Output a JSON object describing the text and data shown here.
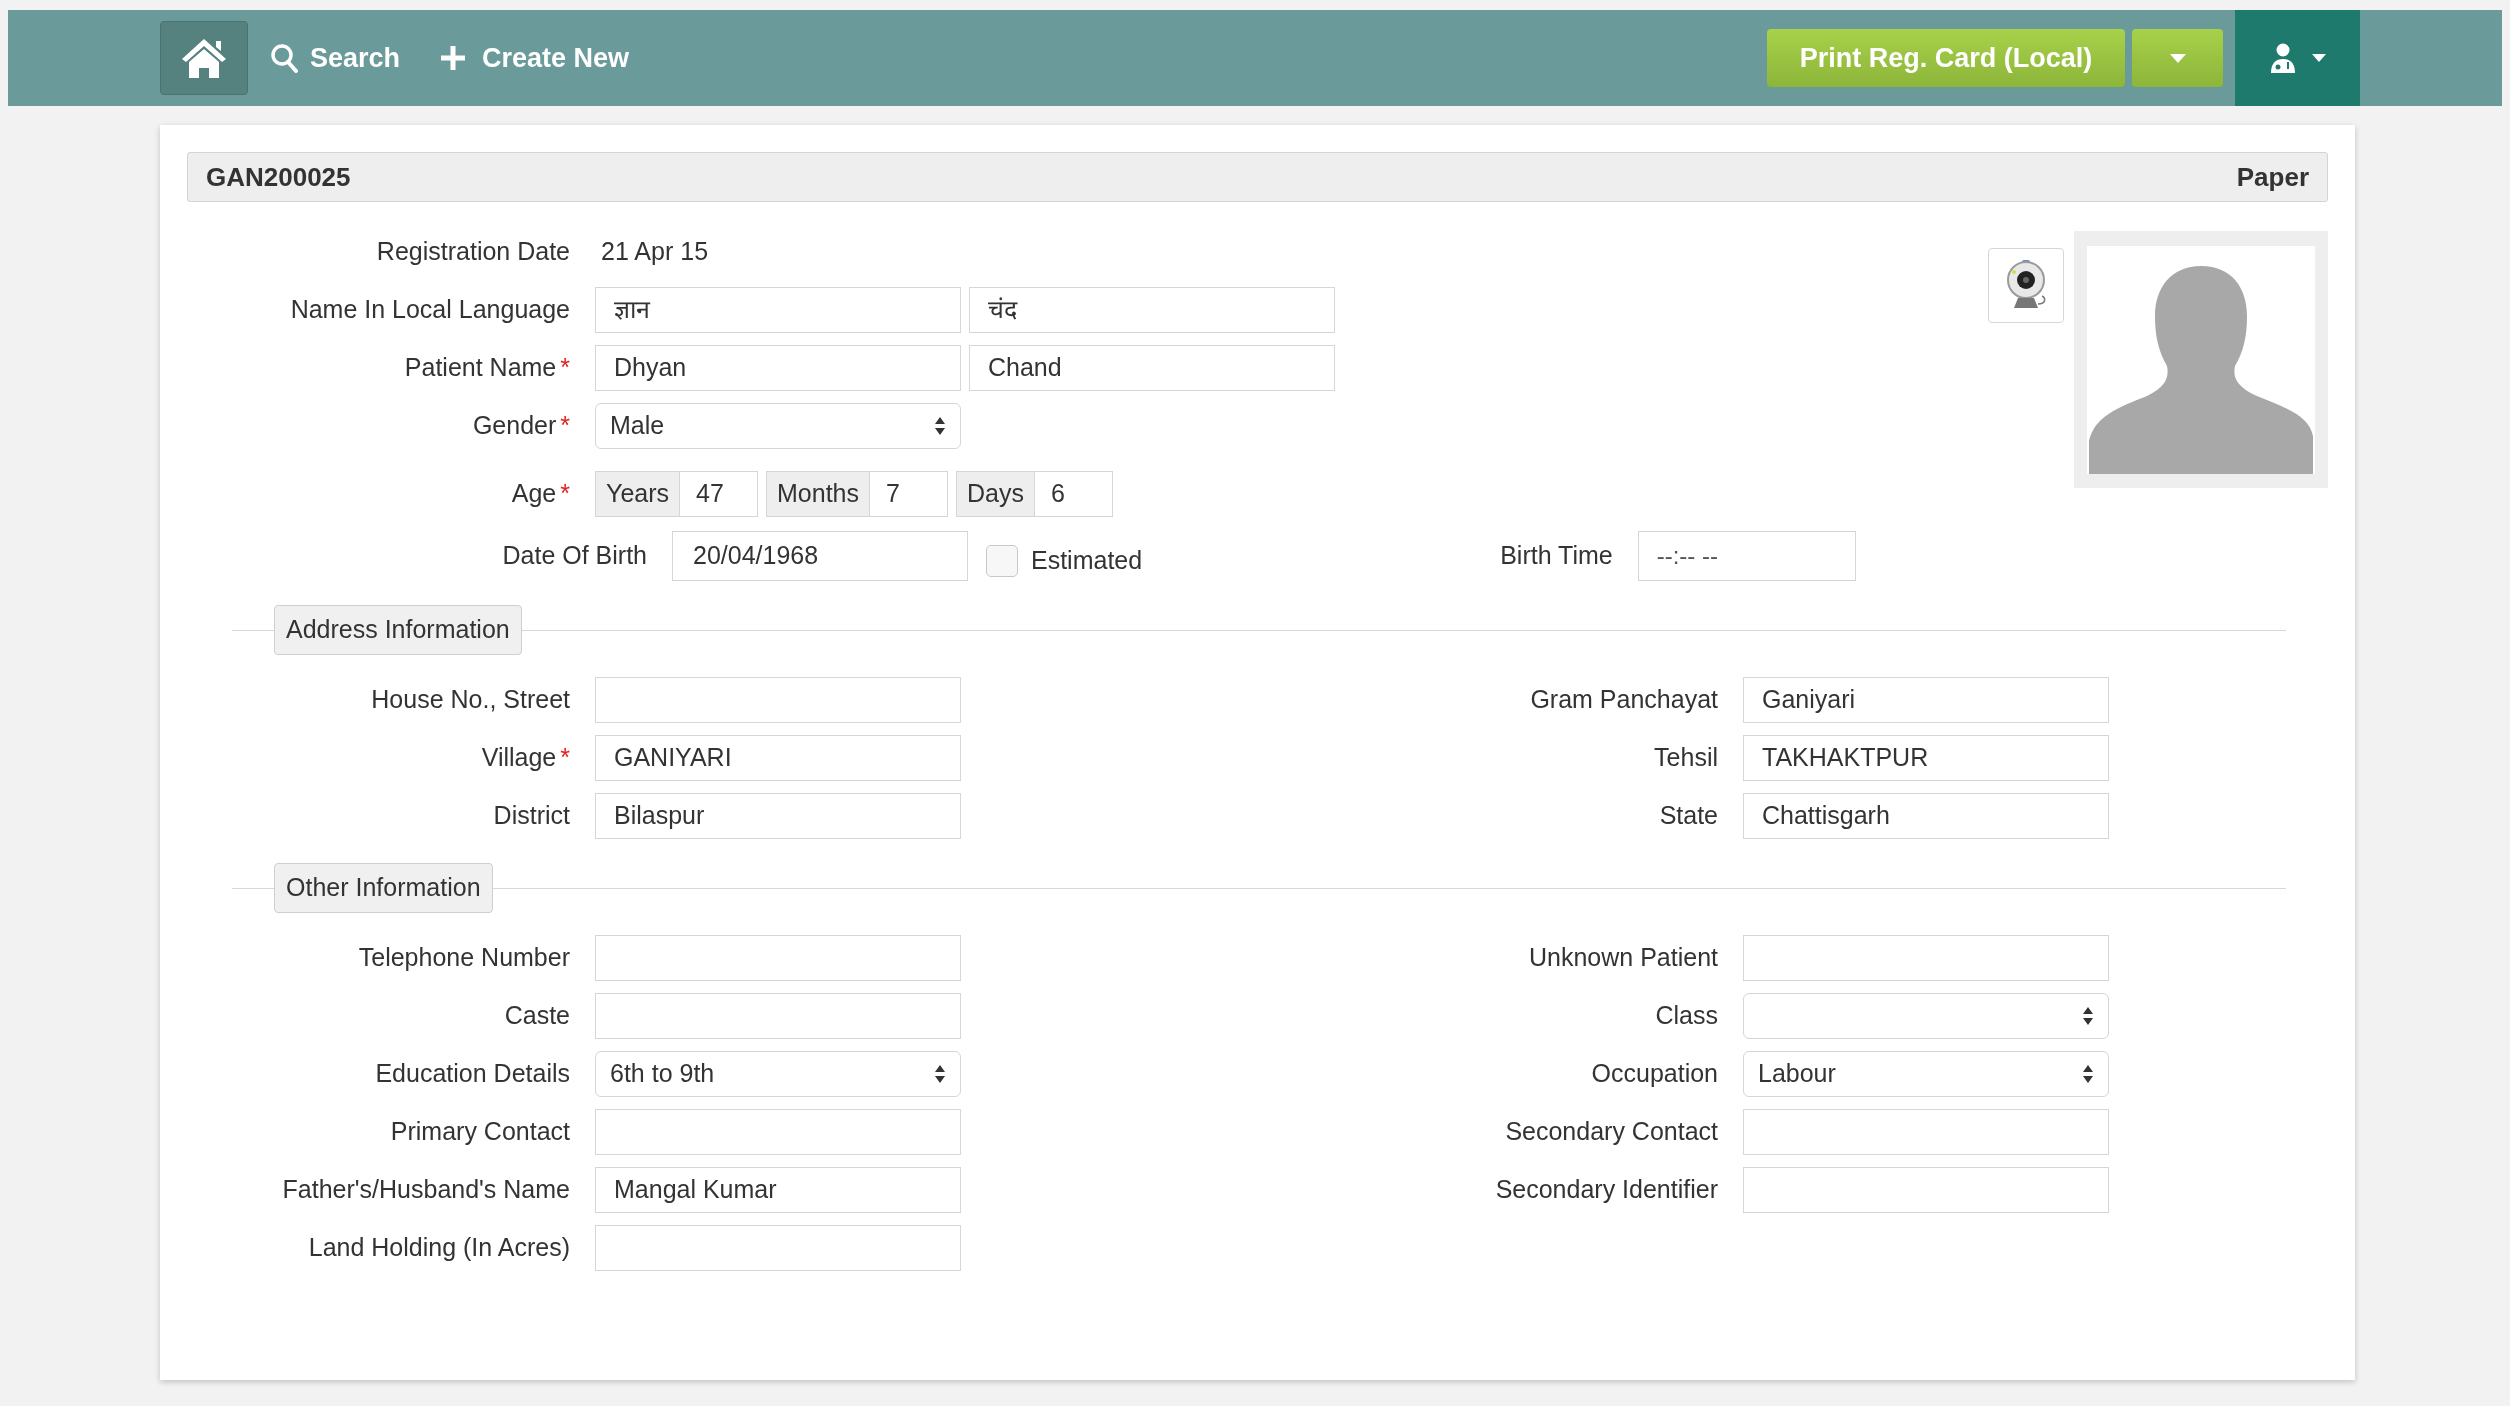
{
  "nav": {
    "search": "Search",
    "create": "Create New",
    "print": "Print Reg. Card (Local)"
  },
  "header": {
    "id": "GAN200025",
    "type": "Paper"
  },
  "registration": {
    "label": "Registration Date",
    "value": "21 Apr 15"
  },
  "local_name": {
    "label": "Name In Local Language",
    "values": [
      "ज्ञान",
      "चंद"
    ]
  },
  "patient_name": {
    "label": "Patient Name",
    "mark": "*",
    "values": [
      "Dhyan",
      "Chand"
    ]
  },
  "gender": {
    "label": "Gender",
    "mark": "*",
    "value": "Male"
  },
  "age": {
    "label": "Age",
    "mark": "*",
    "parts": [
      {
        "unit": "Years",
        "value": "47"
      },
      {
        "unit": "Months",
        "value": "7"
      },
      {
        "unit": "Days",
        "value": "6"
      }
    ]
  },
  "dob": {
    "label": "Date Of Birth",
    "value": "20/04/1968",
    "estimated": {
      "label": "Estimated",
      "checked": false
    }
  },
  "birth_time": {
    "label": "Birth Time",
    "placeholder": "--:-- --"
  },
  "sections": [
    {
      "title": "Address Information",
      "rows": [
        [
          {
            "label": "House No., Street",
            "kind": "text"
          },
          {
            "label": "Gram Panchayat",
            "kind": "text",
            "value": "Ganiyari"
          }
        ],
        [
          {
            "label": "Village",
            "mark": "*",
            "kind": "text",
            "value": "GANIYARI"
          },
          {
            "label": "Tehsil",
            "kind": "text",
            "value": "TAKHAKTPUR"
          }
        ],
        [
          {
            "label": "District",
            "kind": "text",
            "value": "Bilaspur"
          },
          {
            "label": "State",
            "kind": "text",
            "value": "Chattisgarh"
          }
        ]
      ]
    },
    {
      "title": "Other Information",
      "rows": [
        [
          {
            "label": "Telephone Number",
            "kind": "text"
          },
          {
            "label": "Unknown Patient",
            "kind": "text"
          }
        ],
        [
          {
            "label": "Caste",
            "kind": "text"
          },
          {
            "label": "Class",
            "kind": "select"
          }
        ],
        [
          {
            "label": "Education Details",
            "kind": "select",
            "value": "6th to 9th"
          },
          {
            "label": "Occupation",
            "kind": "select",
            "value": "Labour"
          }
        ],
        [
          {
            "label": "Primary Contact",
            "kind": "text"
          },
          {
            "label": "Secondary Contact",
            "kind": "text"
          }
        ],
        [
          {
            "label": "Father's/Husband's Name",
            "kind": "text",
            "value": "Mangal Kumar"
          },
          {
            "label": "Secondary Identifier",
            "kind": "text"
          }
        ],
        [
          {
            "label": "Land Holding (In Acres)",
            "kind": "text"
          }
        ]
      ]
    }
  ]
}
